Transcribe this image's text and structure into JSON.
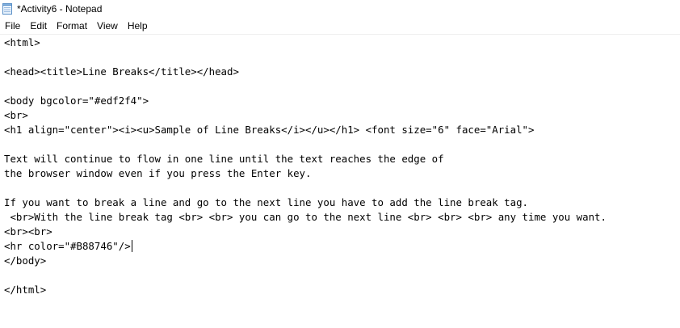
{
  "window": {
    "title": "*Activity6 - Notepad"
  },
  "menu": {
    "file": "File",
    "edit": "Edit",
    "format": "Format",
    "view": "View",
    "help": "Help"
  },
  "editor": {
    "lines": [
      "<html>",
      "",
      "<head><title>Line Breaks</title></head>",
      "",
      "<body bgcolor=\"#edf2f4\">",
      "<br>",
      "<h1 align=\"center\"><i><u>Sample of Line Breaks</i></u></h1> <font size=\"6\" face=\"Arial\">",
      "",
      "Text will continue to flow in one line until the text reaches the edge of",
      "the browser window even if you press the Enter key.",
      "",
      "If you want to break a line and go to the next line you have to add the line break tag.",
      " <br>With the line break tag <br> <br> you can go to the next line <br> <br> <br> any time you want.",
      "<br><br>",
      "<hr color=\"#B88746\"/>",
      "</body>",
      "",
      "</html>"
    ]
  }
}
